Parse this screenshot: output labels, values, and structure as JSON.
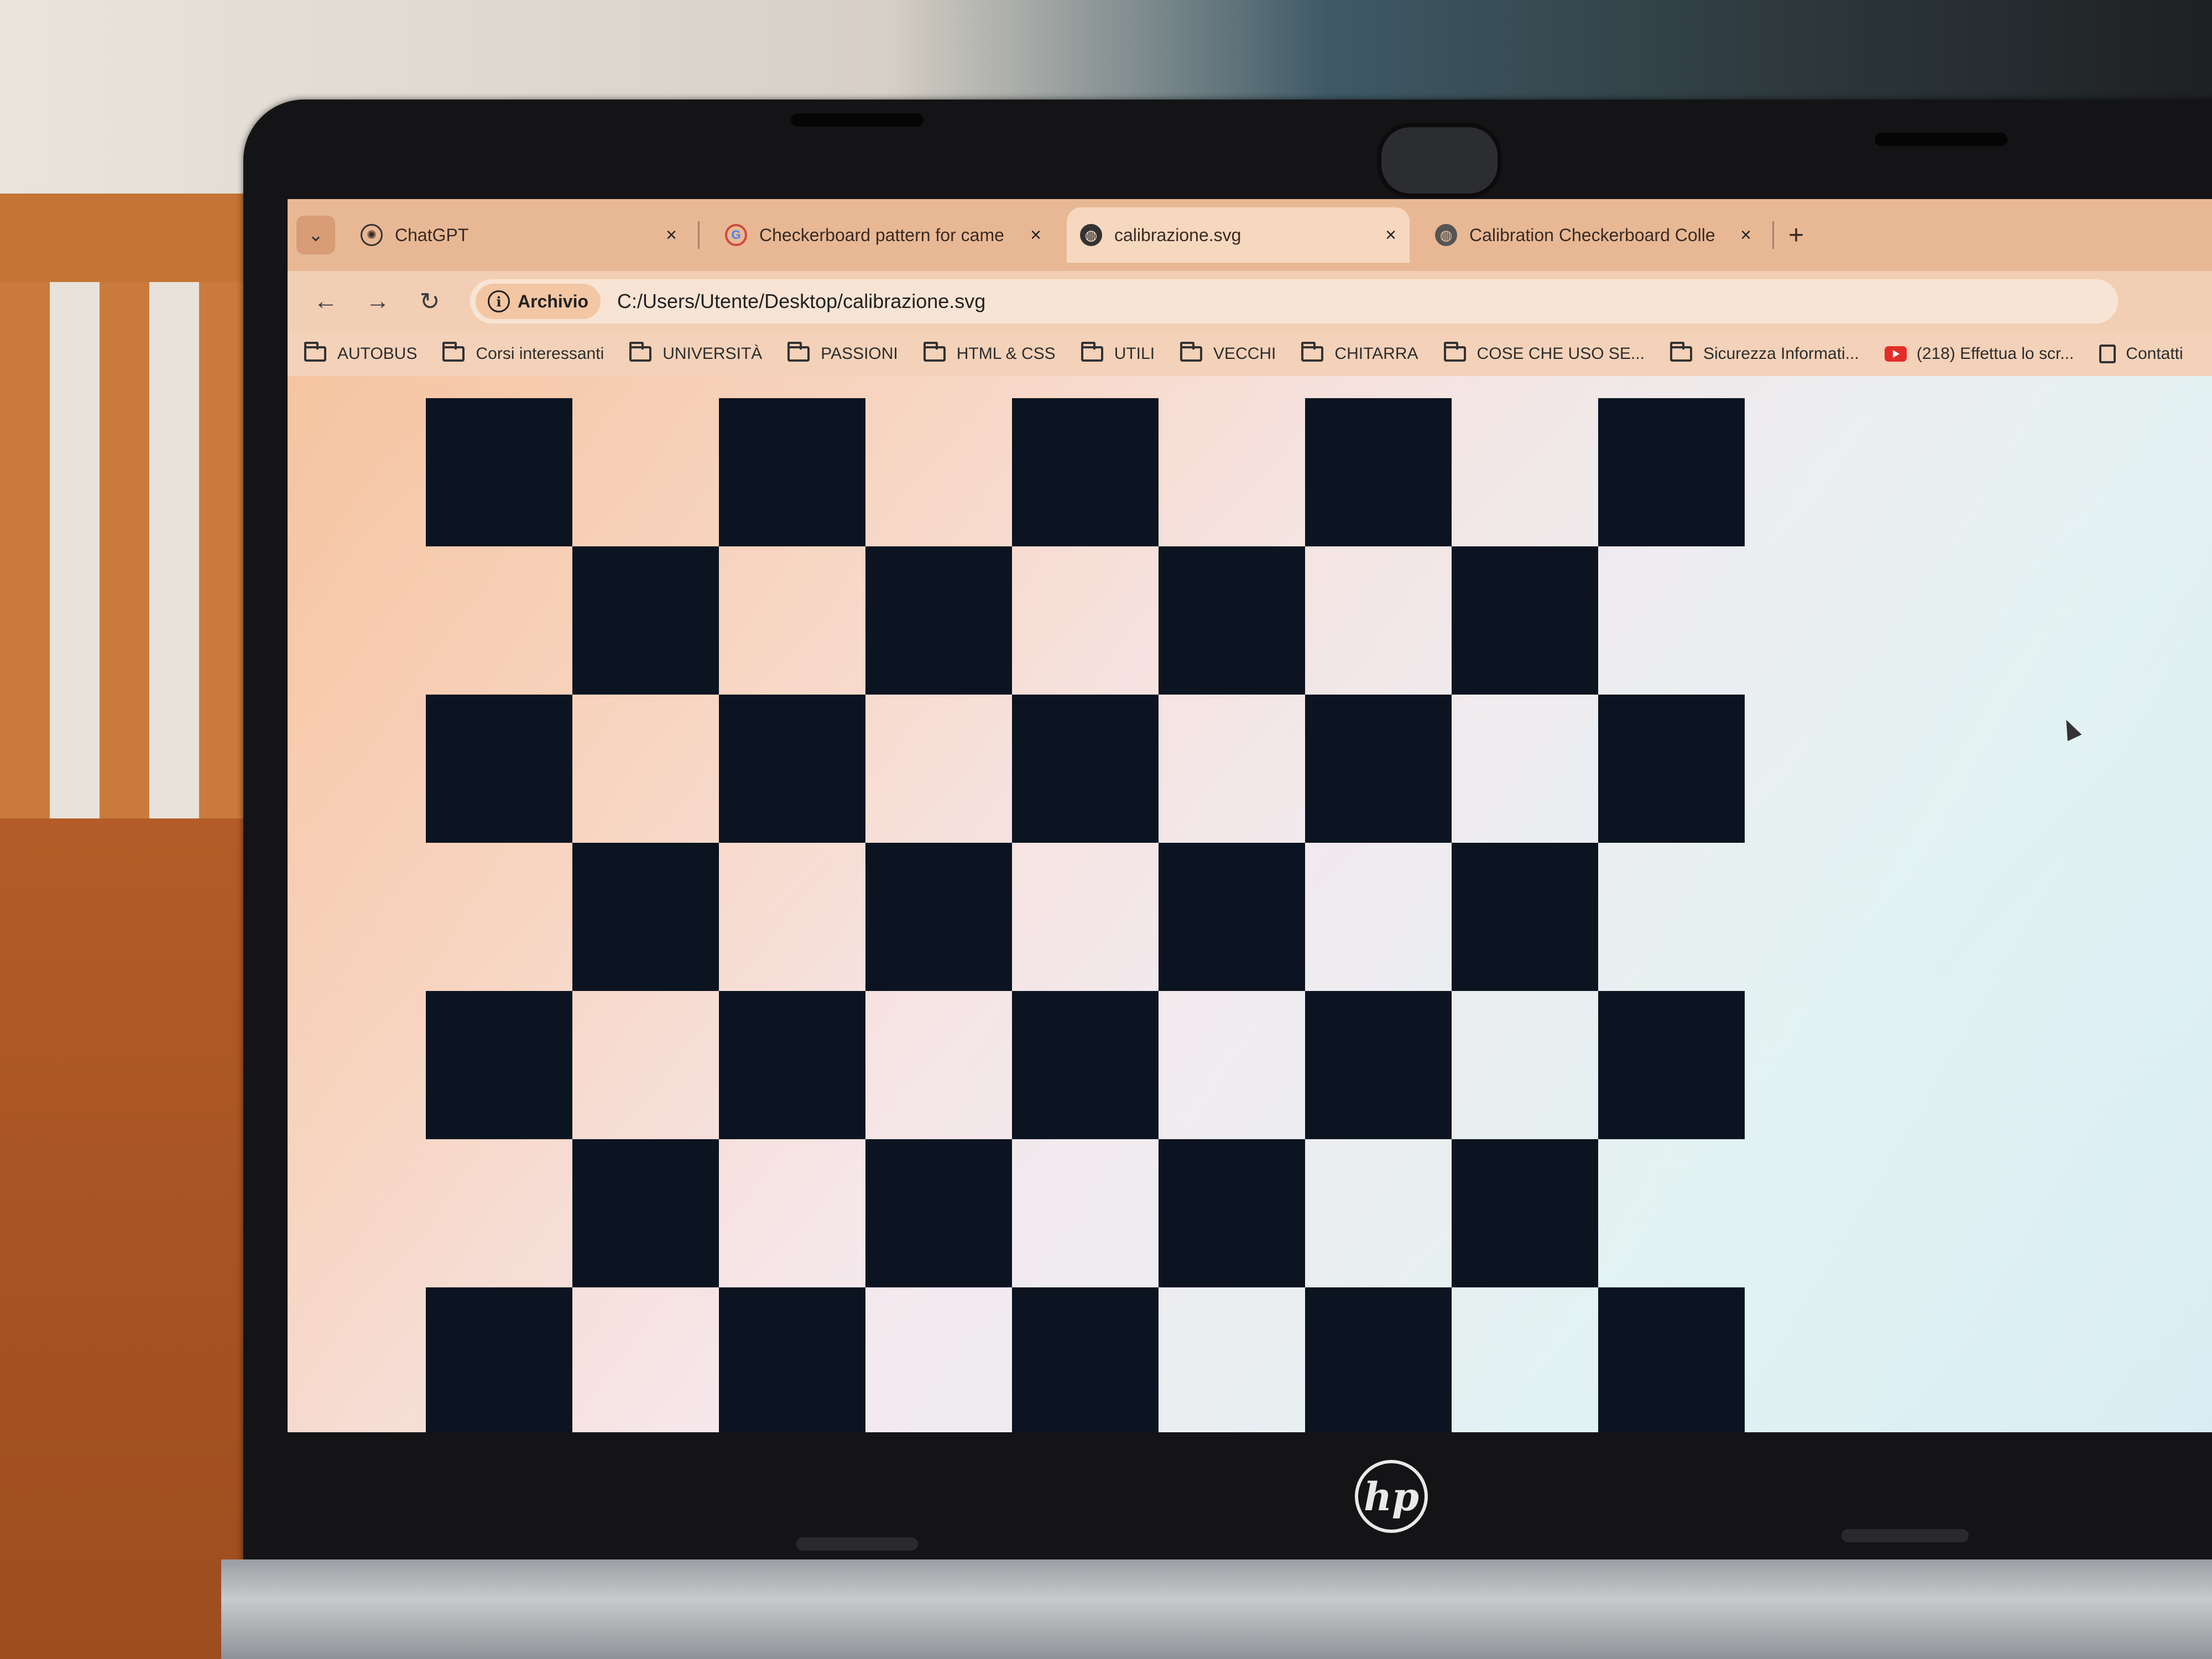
{
  "browser": {
    "tabs": [
      {
        "title": "ChatGPT",
        "icon": "chatgpt-icon",
        "active": false
      },
      {
        "title": "Checkerboard pattern for came",
        "icon": "google-icon",
        "active": false
      },
      {
        "title": "calibrazione.svg",
        "icon": "globe-icon",
        "active": true
      },
      {
        "title": "Calibration Checkerboard Colle",
        "icon": "globe-icon",
        "active": false
      }
    ],
    "close_glyph": "×",
    "new_tab_glyph": "+",
    "tab_list_glyph": "⌄",
    "nav": {
      "back": "←",
      "forward": "→",
      "reload": "↻"
    },
    "omnibox": {
      "chip_icon": "i",
      "chip_label": "Archivio",
      "url": "C:/Users/Utente/Desktop/calibrazione.svg"
    },
    "toolbar_icons": {
      "zoom": "⚲",
      "bookmark": "☆"
    },
    "bookmarks": [
      {
        "label": "AUTOBUS",
        "icon": "folder-icon"
      },
      {
        "label": "Corsi interessanti",
        "icon": "folder-icon"
      },
      {
        "label": "UNIVERSITÀ",
        "icon": "folder-icon"
      },
      {
        "label": "PASSIONI",
        "icon": "folder-icon"
      },
      {
        "label": "HTML & CSS",
        "icon": "folder-icon"
      },
      {
        "label": "UTILI",
        "icon": "folder-icon"
      },
      {
        "label": "VECCHI",
        "icon": "folder-icon"
      },
      {
        "label": "CHITARRA",
        "icon": "folder-icon"
      },
      {
        "label": "COSE CHE USO SE...",
        "icon": "folder-icon"
      },
      {
        "label": "Sicurezza Informati...",
        "icon": "folder-icon"
      },
      {
        "label": "(218) Effettua lo scr...",
        "icon": "youtube-icon"
      },
      {
        "label": "Contatti",
        "icon": "contact-icon"
      }
    ]
  },
  "checkerboard": {
    "columns": 9,
    "rows": 7,
    "dark_color": "#0b1420"
  },
  "laptop": {
    "brand": "hp"
  }
}
